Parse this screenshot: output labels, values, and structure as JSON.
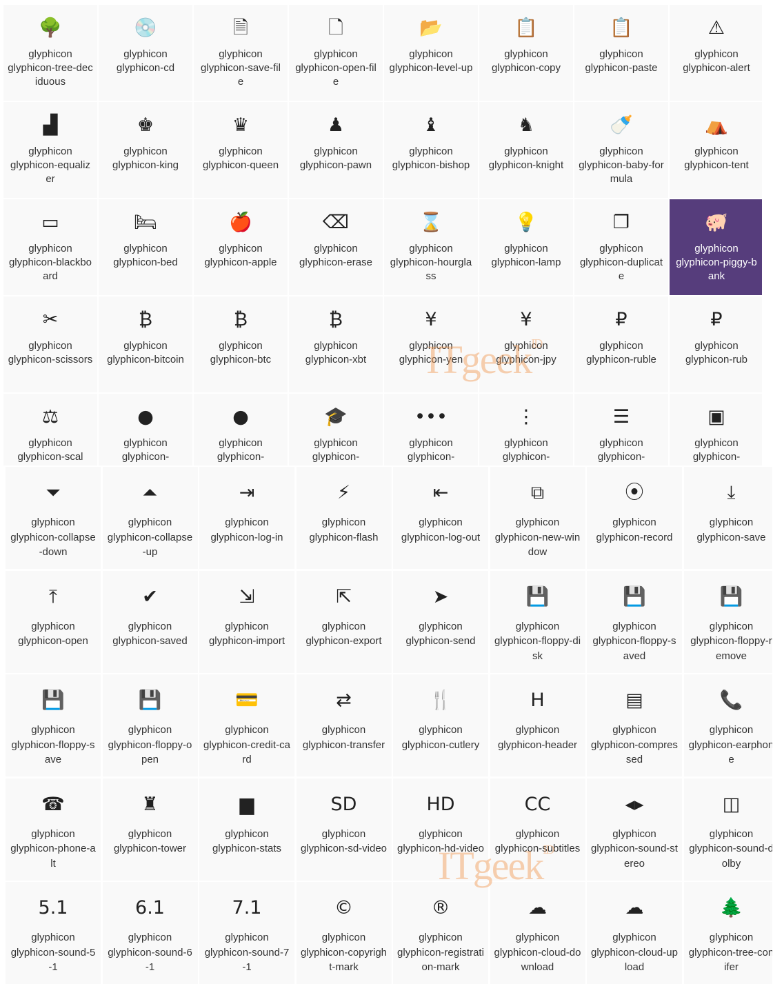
{
  "top_grid": [
    {
      "icon": "tree-deciduous-icon",
      "glyph": "🌳",
      "l1": "glyphicon",
      "l2": "glyphicon-tree-deciduous"
    },
    {
      "icon": "cd-icon",
      "glyph": "💿",
      "l1": "glyphicon",
      "l2": "glyphicon-cd"
    },
    {
      "icon": "save-file-icon",
      "glyph": "🗎",
      "l1": "glyphicon",
      "l2": "glyphicon-save-file"
    },
    {
      "icon": "open-file-icon",
      "glyph": "🗋",
      "l1": "glyphicon",
      "l2": "glyphicon-open-file"
    },
    {
      "icon": "level-up-icon",
      "glyph": "📂",
      "l1": "glyphicon",
      "l2": "glyphicon-level-up"
    },
    {
      "icon": "copy-icon",
      "glyph": "📋",
      "l1": "glyphicon",
      "l2": "glyphicon-copy"
    },
    {
      "icon": "paste-icon",
      "glyph": "📋",
      "l1": "glyphicon",
      "l2": "glyphicon-paste"
    },
    {
      "icon": "alert-icon",
      "glyph": "⚠",
      "l1": "glyphicon",
      "l2": "glyphicon-alert"
    },
    {
      "icon": "equalizer-icon",
      "glyph": "▟",
      "l1": "glyphicon",
      "l2": "glyphicon-equalizer"
    },
    {
      "icon": "king-icon",
      "glyph": "♚",
      "l1": "glyphicon",
      "l2": "glyphicon-king"
    },
    {
      "icon": "queen-icon",
      "glyph": "♛",
      "l1": "glyphicon",
      "l2": "glyphicon-queen"
    },
    {
      "icon": "pawn-icon",
      "glyph": "♟",
      "l1": "glyphicon",
      "l2": "glyphicon-pawn"
    },
    {
      "icon": "bishop-icon",
      "glyph": "♝",
      "l1": "glyphicon",
      "l2": "glyphicon-bishop"
    },
    {
      "icon": "knight-icon",
      "glyph": "♞",
      "l1": "glyphicon",
      "l2": "glyphicon-knight"
    },
    {
      "icon": "baby-formula-icon",
      "glyph": "🍼",
      "l1": "glyphicon",
      "l2": "glyphicon-baby-formula"
    },
    {
      "icon": "tent-icon",
      "glyph": "⛺",
      "l1": "glyphicon",
      "l2": "glyphicon-tent"
    },
    {
      "icon": "blackboard-icon",
      "glyph": "▭",
      "l1": "glyphicon",
      "l2": "glyphicon-blackboard"
    },
    {
      "icon": "bed-icon",
      "glyph": "🛏",
      "l1": "glyphicon",
      "l2": "glyphicon-bed"
    },
    {
      "icon": "apple-icon",
      "glyph": "🍎",
      "l1": "glyphicon",
      "l2": "glyphicon-apple"
    },
    {
      "icon": "erase-icon",
      "glyph": "⌫",
      "l1": "glyphicon",
      "l2": "glyphicon-erase"
    },
    {
      "icon": "hourglass-icon",
      "glyph": "⌛",
      "l1": "glyphicon",
      "l2": "glyphicon-hourglass"
    },
    {
      "icon": "lamp-icon",
      "glyph": "💡",
      "l1": "glyphicon",
      "l2": "glyphicon-lamp"
    },
    {
      "icon": "duplicate-icon",
      "glyph": "❐",
      "l1": "glyphicon",
      "l2": "glyphicon-duplicate"
    },
    {
      "icon": "piggy-bank-icon",
      "glyph": "🐖",
      "l1": "glyphicon",
      "l2": "glyphicon-piggy-bank",
      "active": true
    },
    {
      "icon": "scissors-icon",
      "glyph": "✂",
      "l1": "glyphicon",
      "l2": "glyphicon-scissors"
    },
    {
      "icon": "bitcoin-icon",
      "glyph": "₿",
      "l1": "glyphicon",
      "l2": "glyphicon-bitcoin"
    },
    {
      "icon": "btc-icon",
      "glyph": "₿",
      "l1": "glyphicon",
      "l2": "glyphicon-btc"
    },
    {
      "icon": "xbt-icon",
      "glyph": "₿",
      "l1": "glyphicon",
      "l2": "glyphicon-xbt"
    },
    {
      "icon": "yen-icon",
      "glyph": "¥",
      "l1": "glyphicon",
      "l2": "glyphicon-yen"
    },
    {
      "icon": "jpy-icon",
      "glyph": "¥",
      "l1": "glyphicon",
      "l2": "glyphicon-jpy"
    },
    {
      "icon": "ruble-icon",
      "glyph": "₽",
      "l1": "glyphicon",
      "l2": "glyphicon-ruble"
    },
    {
      "icon": "rub-icon",
      "glyph": "₽",
      "l1": "glyphicon",
      "l2": "glyphicon-rub"
    },
    {
      "icon": "scale-icon",
      "glyph": "⚖",
      "l1": "glyphicon",
      "l2": "glyphicon-scal"
    },
    {
      "icon": "ice-lolly-icon",
      "glyph": "●",
      "l1": "glyphicon",
      "l2": "glyphicon-"
    },
    {
      "icon": "ice-lolly-tasted-icon",
      "glyph": "●",
      "l1": "glyphicon",
      "l2": "glyphicon-"
    },
    {
      "icon": "education-icon",
      "glyph": "🎓",
      "l1": "glyphicon",
      "l2": "glyphicon-"
    },
    {
      "icon": "option-horizontal-icon",
      "glyph": "•••",
      "l1": "glyphicon",
      "l2": "glyphicon-"
    },
    {
      "icon": "option-vertical-icon",
      "glyph": "⋮",
      "l1": "glyphicon",
      "l2": "glyphicon-"
    },
    {
      "icon": "menu-hamburger-icon",
      "glyph": "☰",
      "l1": "glyphicon",
      "l2": "glyphicon-"
    },
    {
      "icon": "modal-window-icon",
      "glyph": "▣",
      "l1": "glyphicon",
      "l2": "glyphicon-"
    }
  ],
  "bottom_grid": [
    {
      "icon": "collapse-down-icon",
      "glyph": "⏷",
      "l1": "glyphicon",
      "l2": "glyphicon-collapse-down"
    },
    {
      "icon": "collapse-up-icon",
      "glyph": "⏶",
      "l1": "glyphicon",
      "l2": "glyphicon-collapse-up"
    },
    {
      "icon": "log-in-icon",
      "glyph": "⇥",
      "l1": "glyphicon",
      "l2": "glyphicon-log-in"
    },
    {
      "icon": "flash-icon",
      "glyph": "⚡",
      "l1": "glyphicon",
      "l2": "glyphicon-flash"
    },
    {
      "icon": "log-out-icon",
      "glyph": "⇤",
      "l1": "glyphicon",
      "l2": "glyphicon-log-out"
    },
    {
      "icon": "new-window-icon",
      "glyph": "⧉",
      "l1": "glyphicon",
      "l2": "glyphicon-new-window"
    },
    {
      "icon": "record-icon",
      "glyph": "⦿",
      "l1": "glyphicon",
      "l2": "glyphicon-record"
    },
    {
      "icon": "save-icon",
      "glyph": "⤓",
      "l1": "glyphicon",
      "l2": "glyphicon-save"
    },
    {
      "icon": "open-icon",
      "glyph": "⤒",
      "l1": "glyphicon",
      "l2": "glyphicon-open"
    },
    {
      "icon": "saved-icon",
      "glyph": "✔",
      "l1": "glyphicon",
      "l2": "glyphicon-saved"
    },
    {
      "icon": "import-icon",
      "glyph": "⇲",
      "l1": "glyphicon",
      "l2": "glyphicon-import"
    },
    {
      "icon": "export-icon",
      "glyph": "⇱",
      "l1": "glyphicon",
      "l2": "glyphicon-export"
    },
    {
      "icon": "send-icon",
      "glyph": "➤",
      "l1": "glyphicon",
      "l2": "glyphicon-send"
    },
    {
      "icon": "floppy-disk-icon",
      "glyph": "💾",
      "l1": "glyphicon",
      "l2": "glyphicon-floppy-disk"
    },
    {
      "icon": "floppy-saved-icon",
      "glyph": "💾",
      "l1": "glyphicon",
      "l2": "glyphicon-floppy-saved"
    },
    {
      "icon": "floppy-remove-icon",
      "glyph": "💾",
      "l1": "glyphicon",
      "l2": "glyphicon-floppy-remove"
    },
    {
      "icon": "floppy-save-icon",
      "glyph": "💾",
      "l1": "glyphicon",
      "l2": "glyphicon-floppy-save"
    },
    {
      "icon": "floppy-open-icon",
      "glyph": "💾",
      "l1": "glyphicon",
      "l2": "glyphicon-floppy-open"
    },
    {
      "icon": "credit-card-icon",
      "glyph": "💳",
      "l1": "glyphicon",
      "l2": "glyphicon-credit-card"
    },
    {
      "icon": "transfer-icon",
      "glyph": "⇄",
      "l1": "glyphicon",
      "l2": "glyphicon-transfer"
    },
    {
      "icon": "cutlery-icon",
      "glyph": "🍴",
      "l1": "glyphicon",
      "l2": "glyphicon-cutlery"
    },
    {
      "icon": "header-icon",
      "glyph": "H",
      "l1": "glyphicon",
      "l2": "glyphicon-header"
    },
    {
      "icon": "compressed-icon",
      "glyph": "▤",
      "l1": "glyphicon",
      "l2": "glyphicon-compressed"
    },
    {
      "icon": "earphone-icon",
      "glyph": "📞",
      "l1": "glyphicon",
      "l2": "glyphicon-earphone"
    },
    {
      "icon": "phone-alt-icon",
      "glyph": "☎",
      "l1": "glyphicon",
      "l2": "glyphicon-phone-alt"
    },
    {
      "icon": "tower-icon",
      "glyph": "♜",
      "l1": "glyphicon",
      "l2": "glyphicon-tower"
    },
    {
      "icon": "stats-icon",
      "glyph": "▆",
      "l1": "glyphicon",
      "l2": "glyphicon-stats"
    },
    {
      "icon": "sd-video-icon",
      "glyph": "SD",
      "l1": "glyphicon",
      "l2": "glyphicon-sd-video"
    },
    {
      "icon": "hd-video-icon",
      "glyph": "HD",
      "l1": "glyphicon",
      "l2": "glyphicon-hd-video"
    },
    {
      "icon": "subtitles-icon",
      "glyph": "CC",
      "l1": "glyphicon",
      "l2": "glyphicon-subtitles"
    },
    {
      "icon": "sound-stereo-icon",
      "glyph": "◂▸",
      "l1": "glyphicon",
      "l2": "glyphicon-sound-stereo"
    },
    {
      "icon": "sound-dolby-icon",
      "glyph": "◫",
      "l1": "glyphicon",
      "l2": "glyphicon-sound-dolby"
    },
    {
      "icon": "sound-5-1-icon",
      "glyph": "5.1",
      "l1": "glyphicon",
      "l2": "glyphicon-sound-5-1"
    },
    {
      "icon": "sound-6-1-icon",
      "glyph": "6.1",
      "l1": "glyphicon",
      "l2": "glyphicon-sound-6-1"
    },
    {
      "icon": "sound-7-1-icon",
      "glyph": "7.1",
      "l1": "glyphicon",
      "l2": "glyphicon-sound-7-1"
    },
    {
      "icon": "copyright-mark-icon",
      "glyph": "©",
      "l1": "glyphicon",
      "l2": "glyphicon-copyright-mark"
    },
    {
      "icon": "registration-mark-icon",
      "glyph": "®",
      "l1": "glyphicon",
      "l2": "glyphicon-registration-mark"
    },
    {
      "icon": "cloud-download-icon",
      "glyph": "☁",
      "l1": "glyphicon",
      "l2": "glyphicon-cloud-download"
    },
    {
      "icon": "cloud-upload-icon",
      "glyph": "☁",
      "l1": "glyphicon",
      "l2": "glyphicon-cloud-upload"
    },
    {
      "icon": "tree-conifer-icon",
      "glyph": "🌲",
      "l1": "glyphicon",
      "l2": "glyphicon-tree-conifer"
    }
  ],
  "watermark": {
    "brand": "ITgeek",
    "suffix": "ID"
  }
}
